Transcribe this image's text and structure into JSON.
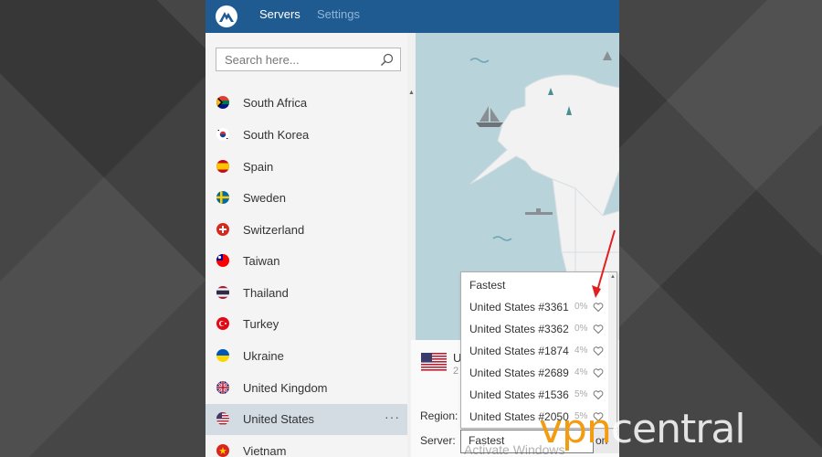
{
  "header": {
    "tabs": [
      {
        "label": "Servers",
        "active": true
      },
      {
        "label": "Settings",
        "active": false
      }
    ],
    "accent": "#1f5b91"
  },
  "search": {
    "placeholder": "Search here..."
  },
  "countries": [
    {
      "name": "South Africa",
      "flag": "south-africa-flag",
      "selected": false
    },
    {
      "name": "South Korea",
      "flag": "south-korea-flag",
      "selected": false
    },
    {
      "name": "Spain",
      "flag": "spain-flag",
      "selected": false
    },
    {
      "name": "Sweden",
      "flag": "sweden-flag",
      "selected": false
    },
    {
      "name": "Switzerland",
      "flag": "switzerland-flag",
      "selected": false
    },
    {
      "name": "Taiwan",
      "flag": "taiwan-flag",
      "selected": false
    },
    {
      "name": "Thailand",
      "flag": "thailand-flag",
      "selected": false
    },
    {
      "name": "Turkey",
      "flag": "turkey-flag",
      "selected": false
    },
    {
      "name": "Ukraine",
      "flag": "ukraine-flag",
      "selected": false
    },
    {
      "name": "United Kingdom",
      "flag": "uk-flag",
      "selected": false
    },
    {
      "name": "United States",
      "flag": "us-flag",
      "selected": true,
      "more": "···"
    },
    {
      "name": "Vietnam",
      "flag": "vietnam-flag",
      "selected": false
    }
  ],
  "info": {
    "title_fragment": "U",
    "subtitle_fragment": "2",
    "region_label": "Region:",
    "server_label": "Server:"
  },
  "server_dropdown": {
    "options": [
      {
        "name": "Fastest",
        "load": "",
        "favorite": false
      },
      {
        "name": "United States #3361",
        "load": "0%",
        "favorite": false
      },
      {
        "name": "United States #3362",
        "load": "0%",
        "favorite": false
      },
      {
        "name": "United States #1874",
        "load": "4%",
        "favorite": false
      },
      {
        "name": "United States #2689",
        "load": "4%",
        "favorite": false
      },
      {
        "name": "United States #1536",
        "load": "5%",
        "favorite": false
      },
      {
        "name": "United States #2050",
        "load": "5%",
        "favorite": false
      }
    ],
    "selected_value": "Fastest"
  },
  "connect_fragment": "on",
  "watermark": "Activate Windows",
  "brand_logo": {
    "prefix": "vpn",
    "suffix": "central",
    "color": "#f39c12"
  }
}
